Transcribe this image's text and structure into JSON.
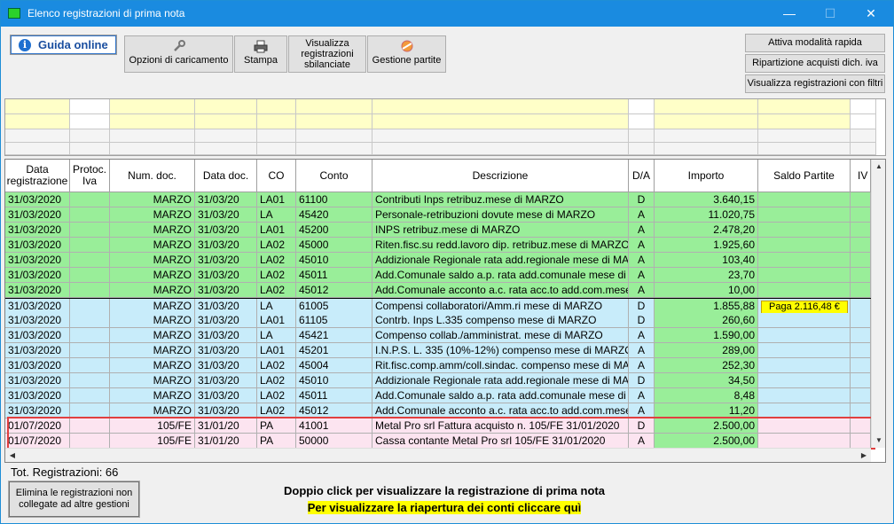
{
  "window": {
    "title": "Elenco registrazioni di prima nota",
    "minimize": "—",
    "maximize": "☐",
    "close": "✕"
  },
  "toolbar": {
    "guida": "Guida online",
    "opzioni": "Opzioni di caricamento",
    "stampa": "Stampa",
    "visualizza1": "Visualizza",
    "visualizza2": "registrazioni",
    "visualizza3": "sbilanciate",
    "gestione": "Gestione partite",
    "attiva": "Attiva modalità rapida",
    "ripartizione": "Ripartizione acquisti dich. iva",
    "filtri": "Visualizza registrazioni con filtri"
  },
  "grid": {
    "headers": {
      "data_reg1": "Data",
      "data_reg2": "registrazione",
      "protoc1": "Protoc.",
      "protoc2": "Iva",
      "num_doc": "Num. doc.",
      "data_doc": "Data doc.",
      "co": "CO",
      "conto": "Conto",
      "descrizione": "Descrizione",
      "da": "D/A",
      "importo": "Importo",
      "saldo": "Saldo Partite",
      "iv": "IV"
    },
    "rows": [
      {
        "data": "31/03/2020",
        "num": "MARZO",
        "ddoc": "31/03/20",
        "co": "LA01",
        "conto": "61100",
        "desc": "Contributi Inps retribuz.mese di MARZO",
        "da": "D",
        "imp": "3.640,15",
        "saldo": "",
        "group": "green"
      },
      {
        "data": "31/03/2020",
        "num": "MARZO",
        "ddoc": "31/03/20",
        "co": "LA",
        "conto": "45420",
        "desc": "Personale-retribuzioni dovute mese di MARZO",
        "da": "A",
        "imp": "11.020,75",
        "saldo": "",
        "group": "green"
      },
      {
        "data": "31/03/2020",
        "num": "MARZO",
        "ddoc": "31/03/20",
        "co": "LA01",
        "conto": "45200",
        "desc": "INPS retribuz.mese di MARZO",
        "da": "A",
        "imp": "2.478,20",
        "saldo": "",
        "group": "green"
      },
      {
        "data": "31/03/2020",
        "num": "MARZO",
        "ddoc": "31/03/20",
        "co": "LA02",
        "conto": "45000",
        "desc": "Riten.fisc.su redd.lavoro dip. retribuz.mese di MARZO",
        "da": "A",
        "imp": "1.925,60",
        "saldo": "",
        "group": "green"
      },
      {
        "data": "31/03/2020",
        "num": "MARZO",
        "ddoc": "31/03/20",
        "co": "LA02",
        "conto": "45010",
        "desc": "Addizionale Regionale rata add.regionale mese di MARZO",
        "da": "A",
        "imp": "103,40",
        "saldo": "",
        "group": "green"
      },
      {
        "data": "31/03/2020",
        "num": "MARZO",
        "ddoc": "31/03/20",
        "co": "LA02",
        "conto": "45011",
        "desc": "Add.Comunale saldo a.p. rata add.comunale mese di MARZO",
        "da": "A",
        "imp": "23,70",
        "saldo": "",
        "group": "green"
      },
      {
        "data": "31/03/2020",
        "num": "MARZO",
        "ddoc": "31/03/20",
        "co": "LA02",
        "conto": "45012",
        "desc": "Add.Comunale acconto a.c. rata acc.to add.com.mese di MARZO",
        "da": "A",
        "imp": "10,00",
        "saldo": "",
        "group": "green"
      },
      {
        "data": "31/03/2020",
        "num": "MARZO",
        "ddoc": "31/03/20",
        "co": "LA",
        "conto": "61005",
        "desc": "Compensi collaboratori/Amm.ri mese di MARZO",
        "da": "D",
        "imp": "1.855,88",
        "saldo": "Paga 2.116,48 €",
        "group": "blue"
      },
      {
        "data": "31/03/2020",
        "num": "MARZO",
        "ddoc": "31/03/20",
        "co": "LA01",
        "conto": "61105",
        "desc": "Contrb. Inps L.335 compenso mese di MARZO",
        "da": "D",
        "imp": "260,60",
        "saldo": "",
        "group": "blue"
      },
      {
        "data": "31/03/2020",
        "num": "MARZO",
        "ddoc": "31/03/20",
        "co": "LA",
        "conto": "45421",
        "desc": "Compenso collab./amministrat. mese di MARZO",
        "da": "A",
        "imp": "1.590,00",
        "saldo": "",
        "group": "blue"
      },
      {
        "data": "31/03/2020",
        "num": "MARZO",
        "ddoc": "31/03/20",
        "co": "LA01",
        "conto": "45201",
        "desc": "I.N.P.S. L. 335 (10%-12%) compenso mese di MARZO",
        "da": "A",
        "imp": "289,00",
        "saldo": "",
        "group": "blue"
      },
      {
        "data": "31/03/2020",
        "num": "MARZO",
        "ddoc": "31/03/20",
        "co": "LA02",
        "conto": "45004",
        "desc": "Rit.fisc.comp.amm/coll.sindac. compenso mese di MARZO",
        "da": "A",
        "imp": "252,30",
        "saldo": "",
        "group": "blue"
      },
      {
        "data": "31/03/2020",
        "num": "MARZO",
        "ddoc": "31/03/20",
        "co": "LA02",
        "conto": "45010",
        "desc": "Addizionale Regionale rata add.regionale mese di MARZO",
        "da": "D",
        "imp": "34,50",
        "saldo": "",
        "group": "blue"
      },
      {
        "data": "31/03/2020",
        "num": "MARZO",
        "ddoc": "31/03/20",
        "co": "LA02",
        "conto": "45011",
        "desc": "Add.Comunale saldo a.p. rata add.comunale mese di MARZO",
        "da": "A",
        "imp": "8,48",
        "saldo": "",
        "group": "blue"
      },
      {
        "data": "31/03/2020",
        "num": "MARZO",
        "ddoc": "31/03/20",
        "co": "LA02",
        "conto": "45012",
        "desc": "Add.Comunale acconto a.c. rata acc.to add.com.mese di MARZO",
        "da": "A",
        "imp": "11,20",
        "saldo": "",
        "group": "blue"
      },
      {
        "data": "01/07/2020",
        "num": "105/FE",
        "ddoc": "31/01/20",
        "co": "PA",
        "conto": "41001",
        "desc": "Metal Pro srl Fattura acquisto n. 105/FE 31/01/2020",
        "da": "D",
        "imp": "2.500,00",
        "saldo": "",
        "group": "pink"
      },
      {
        "data": "01/07/2020",
        "num": "105/FE",
        "ddoc": "31/01/20",
        "co": "PA",
        "conto": "50000",
        "desc": "Cassa contante Metal Pro srl 105/FE 31/01/2020",
        "da": "A",
        "imp": "2.500,00",
        "saldo": "",
        "group": "pink"
      }
    ]
  },
  "footer": {
    "tot": "Tot. Registrazioni: 66",
    "elimina1": "Elimina le registrazioni non",
    "elimina2": "collegate ad altre gestioni",
    "dblclick": "Doppio click per visualizzare la registrazione di prima nota",
    "riapertura": "Per visualizzare la riapertura dei conti cliccare quì"
  },
  "colors": {
    "green": "#99ee99",
    "blue": "#c8ecfa",
    "pink": "#fce4f0",
    "imp_green": "#99ee99",
    "saldo_yellow": "#ffff00",
    "filter_yellow": "#ffffc8"
  }
}
